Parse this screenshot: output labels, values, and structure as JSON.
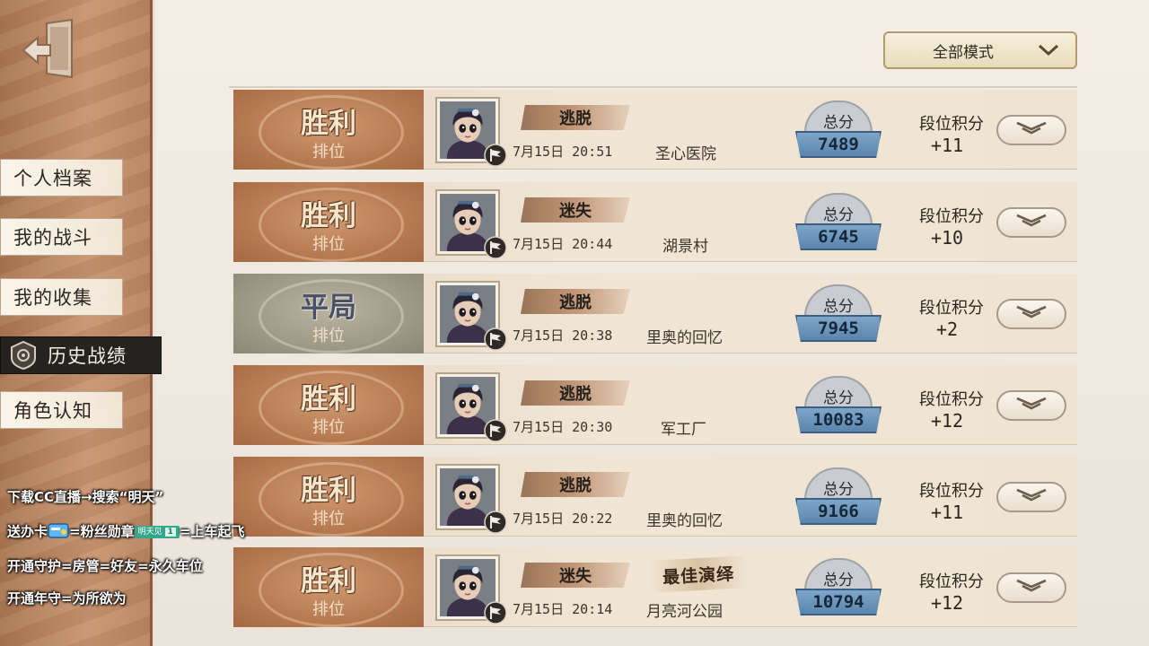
{
  "sidebar": {
    "items": [
      {
        "label": "个人档案"
      },
      {
        "label": "我的战斗"
      },
      {
        "label": "我的收集"
      },
      {
        "label": "历史战绩",
        "active": true
      },
      {
        "label": "角色认知"
      }
    ]
  },
  "filter": {
    "mode": "全部模式"
  },
  "matches": [
    {
      "result": "胜利",
      "type": "排位",
      "side": "逃脱",
      "datetime": "7月15日 20:51",
      "map": "圣心医院",
      "score_label": "总分",
      "score": "7489",
      "rank_label": "段位积分",
      "rank_points": "+11",
      "best_performance": ""
    },
    {
      "result": "胜利",
      "type": "排位",
      "side": "迷失",
      "datetime": "7月15日 20:44",
      "map": "湖景村",
      "score_label": "总分",
      "score": "6745",
      "rank_label": "段位积分",
      "rank_points": "+10",
      "best_performance": ""
    },
    {
      "result": "平局",
      "type": "排位",
      "side": "逃脱",
      "datetime": "7月15日 20:38",
      "map": "里奥的回忆",
      "score_label": "总分",
      "score": "7945",
      "rank_label": "段位积分",
      "rank_points": "+2",
      "best_performance": ""
    },
    {
      "result": "胜利",
      "type": "排位",
      "side": "逃脱",
      "datetime": "7月15日 20:30",
      "map": "军工厂",
      "score_label": "总分",
      "score": "10083",
      "rank_label": "段位积分",
      "rank_points": "+12",
      "best_performance": ""
    },
    {
      "result": "胜利",
      "type": "排位",
      "side": "逃脱",
      "datetime": "7月15日 20:22",
      "map": "里奥的回忆",
      "score_label": "总分",
      "score": "9166",
      "rank_label": "段位积分",
      "rank_points": "+11",
      "best_performance": ""
    },
    {
      "result": "胜利",
      "type": "排位",
      "side": "迷失",
      "datetime": "7月15日 20:14",
      "map": "月亮河公园",
      "score_label": "总分",
      "score": "10794",
      "rank_label": "段位积分",
      "rank_points": "+12",
      "best_performance": "最佳演绎"
    }
  ],
  "overlay": {
    "line1": "下载CC直播→搜索“明天”",
    "line2_pre": "送办卡",
    "line2_mid": "=粉丝勋章",
    "medal_name": "明天见",
    "medal_level": "1",
    "line2_post": "=上车起飞",
    "line3": "开通守护=房管=好友=永久车位",
    "line4": "开通年守=为所欲为"
  },
  "icons": {
    "exit": "exit-door-icon",
    "active_nav": "badge-emblem-icon",
    "expand": "double-chevron-down-icon",
    "portrait": "character-portrait",
    "flag": "white-flag-icon"
  },
  "colors": {
    "win_badge": "#b67a51",
    "draw_badge": "#9f9a86",
    "score_blue": "#5b85ad",
    "active_nav": "#26221f"
  }
}
